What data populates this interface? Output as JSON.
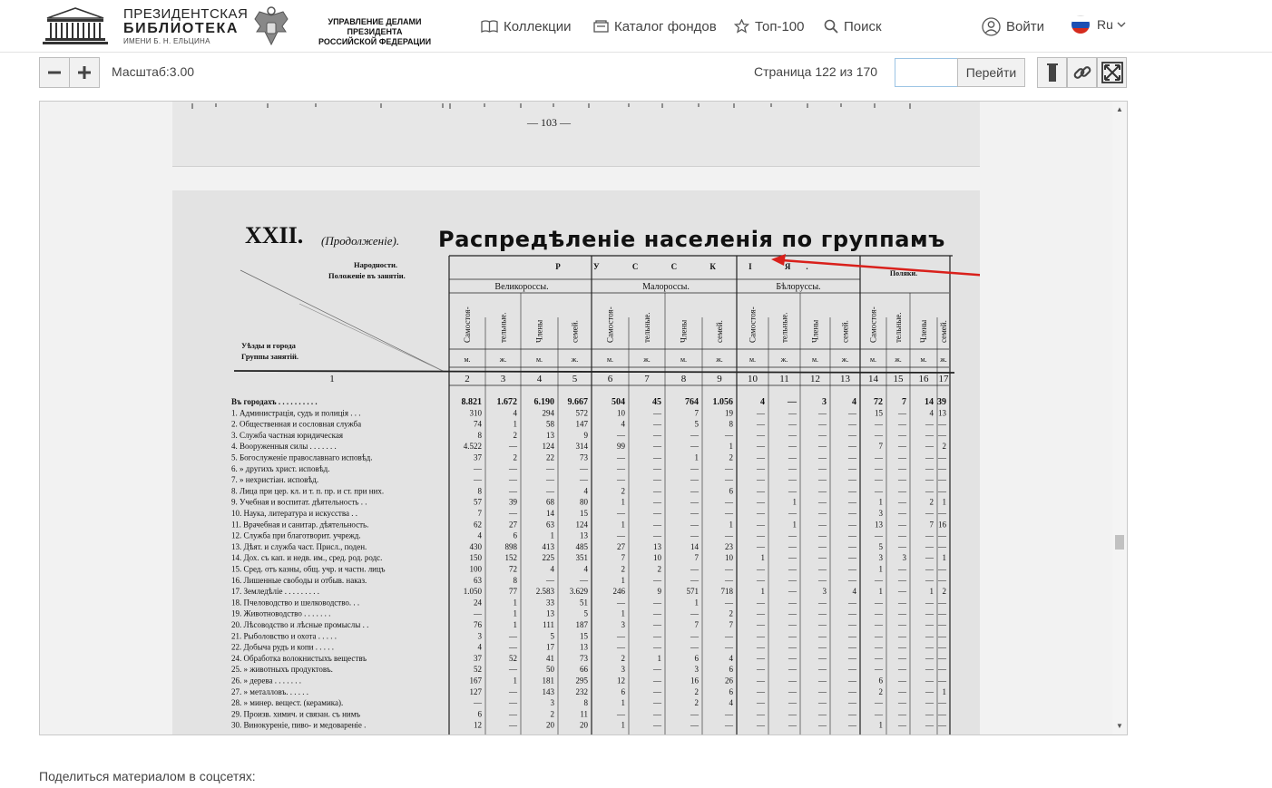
{
  "header": {
    "logo_line1": "ПРЕЗИДЕНТСКАЯ",
    "logo_line2": "БИБЛИОТЕКА",
    "logo_line3": "ИМЕНИ Б. Н. ЕЛЬЦИНА",
    "admin_line1": "УПРАВЛЕНИЕ ДЕЛАМИ ПРЕЗИДЕНТА",
    "admin_line2": "РОССИЙСКОЙ ФЕДЕРАЦИИ",
    "nav": {
      "collections": "Коллекции",
      "catalog": "Каталог фондов",
      "top100": "Топ-100",
      "search": "Поиск"
    },
    "login": "Войти",
    "lang": "Ru"
  },
  "toolbar": {
    "scale_label": "Масштаб:3.00",
    "page_info": "Страница 122 из 170",
    "page_input_value": "",
    "go_label": "Перейти"
  },
  "document": {
    "page_number_top": "— 103 —",
    "table_roman": "XXII.",
    "table_cont": "(Продолженіе).",
    "table_title": "Распредѣленіе населенія по группамъ",
    "hdr_nationality": "Народности.",
    "hdr_position": "Положеніе въ занятіи.",
    "hdr_uezdy": "Уѣзды и города",
    "hdr_groups": "Группы занятій.",
    "hdr_russians": "Р У С С К І Я.",
    "hdr_great": "Великороссы.",
    "hdr_little": "Малороссы.",
    "hdr_white": "Бѣлоруссы.",
    "hdr_poles": "Поляки.",
    "sub_self": "Самостоя- тельные.",
    "sub_family": "Члены семей.",
    "col_numbers": [
      "1",
      "2",
      "3",
      "4",
      "5",
      "6",
      "7",
      "8",
      "9",
      "10",
      "11",
      "12",
      "13",
      "14",
      "15",
      "16",
      "17"
    ],
    "mf": [
      "м.",
      "ж.",
      "м.",
      "ж.",
      "м.",
      "ж.",
      "м.",
      "ж.",
      "м.",
      "ж.",
      "м.",
      "ж.",
      "м.",
      "ж.",
      "м.",
      "ж."
    ],
    "rows": [
      {
        "label": "Въ городахъ . . . . . . . . . .",
        "v": [
          "8.821",
          "1.672",
          "6.190",
          "9.667",
          "504",
          "45",
          "764",
          "1.056",
          "4",
          "—",
          "3",
          "4",
          "72",
          "7",
          "14",
          "39"
        ],
        "bold": true
      },
      {
        "label": "1. Администрація, судъ и полиція . . .",
        "v": [
          "310",
          "4",
          "294",
          "572",
          "10",
          "—",
          "7",
          "19",
          "—",
          "—",
          "—",
          "—",
          "15",
          "—",
          "4",
          "13"
        ]
      },
      {
        "label": "2. Общественная и сословная служба",
        "v": [
          "74",
          "1",
          "58",
          "147",
          "4",
          "—",
          "5",
          "8",
          "—",
          "—",
          "—",
          "—",
          "—",
          "—",
          "—",
          "—"
        ]
      },
      {
        "label": "3. Служба частная юридическая",
        "v": [
          "8",
          "2",
          "13",
          "9",
          "—",
          "—",
          "—",
          "—",
          "—",
          "—",
          "—",
          "—",
          "—",
          "—",
          "—",
          "—"
        ]
      },
      {
        "label": "4. Вооруженныя силы . . . . . . .",
        "v": [
          "4.522",
          "—",
          "124",
          "314",
          "99",
          "—",
          "—",
          "1",
          "—",
          "—",
          "—",
          "—",
          "7",
          "—",
          "—",
          "2"
        ]
      },
      {
        "label": "5. Богослуженіе православнаго исповѣд.",
        "v": [
          "37",
          "2",
          "22",
          "73",
          "—",
          "—",
          "1",
          "2",
          "—",
          "—",
          "—",
          "—",
          "—",
          "—",
          "—",
          "—"
        ]
      },
      {
        "label": "6.      »     другихъ христ. исповѣд.",
        "v": [
          "—",
          "—",
          "—",
          "—",
          "—",
          "—",
          "—",
          "—",
          "—",
          "—",
          "—",
          "—",
          "—",
          "—",
          "—",
          "—"
        ]
      },
      {
        "label": "7.      »     нехристіан. исповѣд.",
        "v": [
          "—",
          "—",
          "—",
          "—",
          "—",
          "—",
          "—",
          "—",
          "—",
          "—",
          "—",
          "—",
          "—",
          "—",
          "—",
          "—"
        ]
      },
      {
        "label": "8. Лица при цер. кл. и т. п. пр. и ст. при них.",
        "v": [
          "8",
          "—",
          "—",
          "4",
          "2",
          "—",
          "—",
          "6",
          "—",
          "—",
          "—",
          "—",
          "—",
          "—",
          "—",
          "—"
        ]
      },
      {
        "label": "9. Учебная и воспитат. дѣятельность . .",
        "v": [
          "57",
          "39",
          "68",
          "80",
          "1",
          "—",
          "—",
          "—",
          "—",
          "1",
          "—",
          "—",
          "1",
          "—",
          "2",
          "1"
        ]
      },
      {
        "label": "10. Наука, литература и искусства . .",
        "v": [
          "7",
          "—",
          "14",
          "15",
          "—",
          "—",
          "—",
          "—",
          "—",
          "—",
          "—",
          "—",
          "3",
          "—",
          "—",
          "—"
        ]
      },
      {
        "label": "11. Врачебная и санитар. дѣятельность.",
        "v": [
          "62",
          "27",
          "63",
          "124",
          "1",
          "—",
          "—",
          "1",
          "—",
          "1",
          "—",
          "—",
          "13",
          "—",
          "7",
          "16"
        ]
      },
      {
        "label": "12. Служба при благотворит. учрежд.",
        "v": [
          "4",
          "6",
          "1",
          "13",
          "—",
          "—",
          "—",
          "—",
          "—",
          "—",
          "—",
          "—",
          "—",
          "—",
          "—",
          "—"
        ]
      },
      {
        "label": "13. Дѣят. и служба част. Присл., поден.",
        "v": [
          "430",
          "898",
          "413",
          "485",
          "27",
          "13",
          "14",
          "23",
          "—",
          "—",
          "—",
          "—",
          "5",
          "—",
          "—",
          "—"
        ]
      },
      {
        "label": "14. Дох. съ кап. и недв. им., сред. род. родс.",
        "v": [
          "150",
          "152",
          "225",
          "351",
          "7",
          "10",
          "7",
          "10",
          "1",
          "—",
          "—",
          "—",
          "3",
          "3",
          "—",
          "1"
        ]
      },
      {
        "label": "15. Сред. отъ казны, общ. учр. и частн. лицъ",
        "v": [
          "100",
          "72",
          "4",
          "4",
          "2",
          "2",
          "—",
          "—",
          "—",
          "—",
          "—",
          "—",
          "1",
          "—",
          "—",
          "—"
        ]
      },
      {
        "label": "16. Лишенные свободы и отбыв. наказ.",
        "v": [
          "63",
          "8",
          "—",
          "—",
          "1",
          "—",
          "—",
          "—",
          "—",
          "—",
          "—",
          "—",
          "—",
          "—",
          "—",
          "—"
        ]
      },
      {
        "label": "17. Земледѣліе . . . . . . . . .",
        "v": [
          "1.050",
          "77",
          "2.583",
          "3.629",
          "246",
          "9",
          "571",
          "718",
          "1",
          "—",
          "3",
          "4",
          "1",
          "—",
          "1",
          "2"
        ]
      },
      {
        "label": "18. Пчеловодство и шелководство. . .",
        "v": [
          "24",
          "1",
          "33",
          "51",
          "—",
          "—",
          "1",
          "—",
          "—",
          "—",
          "—",
          "—",
          "—",
          "—",
          "—",
          "—"
        ]
      },
      {
        "label": "19. Животноводство . . . . . . .",
        "v": [
          "—",
          "1",
          "13",
          "5",
          "1",
          "—",
          "—",
          "2",
          "—",
          "—",
          "—",
          "—",
          "—",
          "—",
          "—",
          "—"
        ]
      },
      {
        "label": "20. Лѣсоводство и лѣсные промыслы . .",
        "v": [
          "76",
          "1",
          "111",
          "187",
          "3",
          "—",
          "7",
          "7",
          "—",
          "—",
          "—",
          "—",
          "—",
          "—",
          "—",
          "—"
        ]
      },
      {
        "label": "21. Рыболовство и охота . . . . .",
        "v": [
          "3",
          "—",
          "5",
          "15",
          "—",
          "—",
          "—",
          "—",
          "—",
          "—",
          "—",
          "—",
          "—",
          "—",
          "—",
          "—"
        ]
      },
      {
        "label": "22. Добыча рудъ и копи . . . . .",
        "v": [
          "4",
          "—",
          "17",
          "13",
          "—",
          "—",
          "—",
          "—",
          "—",
          "—",
          "—",
          "—",
          "—",
          "—",
          "—",
          "—"
        ]
      },
      {
        "label": "24. Обработка волокнистыхъ веществъ",
        "v": [
          "37",
          "52",
          "41",
          "73",
          "2",
          "1",
          "6",
          "4",
          "—",
          "—",
          "—",
          "—",
          "—",
          "—",
          "—",
          "—"
        ]
      },
      {
        "label": "25.      »     животныхъ продуктовъ.",
        "v": [
          "52",
          "—",
          "50",
          "66",
          "3",
          "—",
          "3",
          "6",
          "—",
          "—",
          "—",
          "—",
          "—",
          "—",
          "—",
          "—"
        ]
      },
      {
        "label": "26.      »     дерева . . . . . . .",
        "v": [
          "167",
          "1",
          "181",
          "295",
          "12",
          "—",
          "16",
          "26",
          "—",
          "—",
          "—",
          "—",
          "6",
          "—",
          "—",
          "—"
        ]
      },
      {
        "label": "27.      »     металловъ. . . . . .",
        "v": [
          "127",
          "—",
          "143",
          "232",
          "6",
          "—",
          "2",
          "6",
          "—",
          "—",
          "—",
          "—",
          "2",
          "—",
          "—",
          "1"
        ]
      },
      {
        "label": "28.      »     минер. вещест. (керамика).",
        "v": [
          "—",
          "—",
          "3",
          "8",
          "1",
          "—",
          "2",
          "4",
          "—",
          "—",
          "—",
          "—",
          "—",
          "—",
          "—",
          "—"
        ]
      },
      {
        "label": "29. Произв. химич. и связан. съ нимъ",
        "v": [
          "6",
          "—",
          "2",
          "11",
          "—",
          "—",
          "—",
          "—",
          "—",
          "—",
          "—",
          "—",
          "—",
          "—",
          "—",
          "—"
        ]
      },
      {
        "label": "30. Винокуреніе, пиво- и медовареніе .",
        "v": [
          "12",
          "—",
          "20",
          "20",
          "1",
          "—",
          "—",
          "—",
          "—",
          "—",
          "—",
          "—",
          "1",
          "—",
          "—",
          "—"
        ]
      }
    ]
  },
  "share_label": "Поделиться материалом в соцсетях:",
  "colors": {
    "accent": "#d9201b",
    "border": "#bdbdbd",
    "button_bg": "#f1f1f1"
  }
}
